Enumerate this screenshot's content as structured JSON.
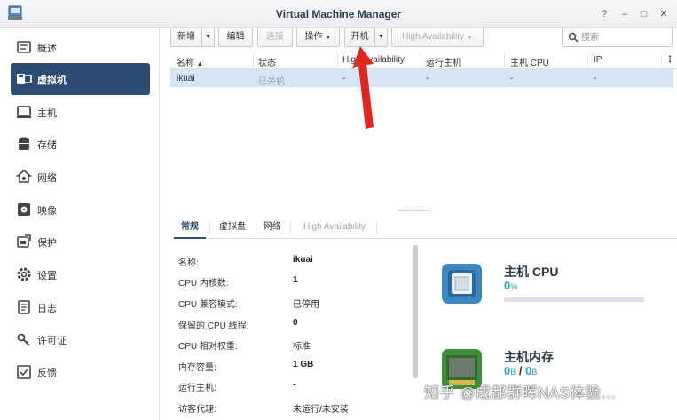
{
  "window": {
    "title": "Virtual Machine Manager",
    "help": "?",
    "minimize": "–",
    "maximize": "□",
    "close": "✕"
  },
  "sidebar": {
    "items": [
      {
        "label": "概述",
        "icon": "overview-icon",
        "active": false
      },
      {
        "label": "虚拟机",
        "icon": "virtual-machine-icon",
        "active": true
      },
      {
        "label": "主机",
        "icon": "host-icon",
        "active": false
      },
      {
        "label": "存储",
        "icon": "storage-icon",
        "active": false
      },
      {
        "label": "网络",
        "icon": "network-icon",
        "active": false
      },
      {
        "label": "映像",
        "icon": "image-icon",
        "active": false
      },
      {
        "label": "保护",
        "icon": "protection-icon",
        "active": false
      },
      {
        "label": "设置",
        "icon": "settings-icon",
        "active": false
      },
      {
        "label": "日志",
        "icon": "log-icon",
        "active": false
      },
      {
        "label": "许可证",
        "icon": "license-icon",
        "active": false
      },
      {
        "label": "反馈",
        "icon": "feedback-icon",
        "active": false
      }
    ]
  },
  "toolbar": {
    "create": "新增",
    "edit": "编辑",
    "connect": "连接",
    "action": "操作",
    "power_on": "开机",
    "high_availability": "High Availability",
    "search_placeholder": "搜索"
  },
  "grid": {
    "columns": [
      "名称",
      "状态",
      "High Availability",
      "运行主机",
      "主机 CPU",
      "IP"
    ],
    "sort_indicator": "▲",
    "menu": "⋮",
    "rows": [
      {
        "name": "ikuai",
        "status": "已关机",
        "ha": "-",
        "host": "-",
        "cpu": "-",
        "ip": "-"
      }
    ]
  },
  "tabs": [
    {
      "label": "常规",
      "active": true,
      "disabled": false
    },
    {
      "label": "虚拟盘",
      "active": false,
      "disabled": false
    },
    {
      "label": "网络",
      "active": false,
      "disabled": false
    },
    {
      "label": "High Availability",
      "active": false,
      "disabled": true
    }
  ],
  "properties": [
    {
      "label": "名称:",
      "value": "ikuai"
    },
    {
      "label": "CPU 内核数:",
      "value": "1"
    },
    {
      "label": "CPU 兼容模式:",
      "value": "已停用"
    },
    {
      "label": "保留的 CPU 线程:",
      "value": "0"
    },
    {
      "label": "CPU 相对权重:",
      "value": "标准"
    },
    {
      "label": "内存容量:",
      "value": "1 GB"
    },
    {
      "label": "运行主机:",
      "value": "-"
    },
    {
      "label": "访客代理:",
      "value": "未运行/未安装"
    }
  ],
  "resources": {
    "cpu": {
      "title": "主机 CPU",
      "value": "0",
      "unit": "%",
      "usage_fraction": 0
    },
    "memory": {
      "title": "主机内存",
      "used": "0",
      "used_unit": "B",
      "slash": "/",
      "total": "0",
      "total_unit": "B",
      "usage_fraction": 0
    }
  },
  "watermark": "知乎 @成都群晖NAS体验…",
  "colors": {
    "accent": "#2c4c73",
    "selection": "#d6e6f7",
    "teal": "#2aa7b3",
    "arrow": "#e0261e"
  }
}
